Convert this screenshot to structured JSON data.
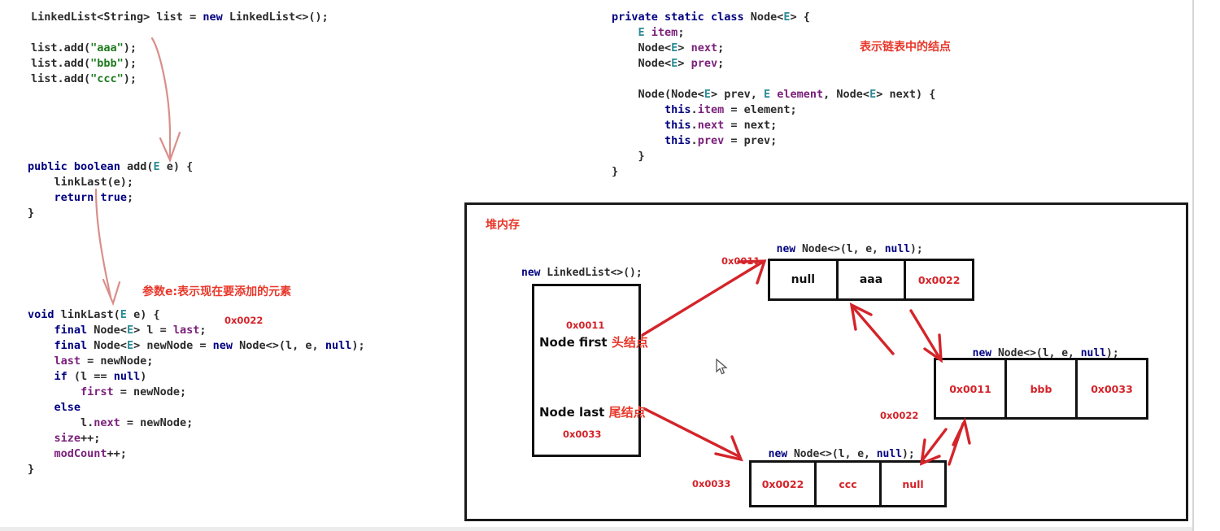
{
  "left_code_top": {
    "lines": [
      [
        {
          "t": "LinkedList<String> list = ",
          "c": "pln"
        },
        {
          "t": "new",
          "c": "kw"
        },
        {
          "t": " LinkedList<>();",
          "c": "pln"
        }
      ],
      [],
      [
        {
          "t": "list.add(",
          "c": "pln"
        },
        {
          "t": "\"aaa\"",
          "c": "str"
        },
        {
          "t": ");",
          "c": "pln"
        }
      ],
      [
        {
          "t": "list.add(",
          "c": "pln"
        },
        {
          "t": "\"bbb\"",
          "c": "str"
        },
        {
          "t": ");",
          "c": "pln"
        }
      ],
      [
        {
          "t": "list.add(",
          "c": "pln"
        },
        {
          "t": "\"ccc\"",
          "c": "str"
        },
        {
          "t": ");",
          "c": "pln"
        }
      ]
    ]
  },
  "left_code_add": {
    "lines": [
      [
        {
          "t": "public",
          "c": "kw"
        },
        {
          "t": " ",
          "c": "pln"
        },
        {
          "t": "boolean",
          "c": "kw"
        },
        {
          "t": " add(",
          "c": "pln"
        },
        {
          "t": "E",
          "c": "tv"
        },
        {
          "t": " e) {",
          "c": "pln"
        }
      ],
      [
        {
          "t": "    linkLast(e);",
          "c": "pln"
        }
      ],
      [
        {
          "t": "    ",
          "c": "pln"
        },
        {
          "t": "return",
          "c": "kw"
        },
        {
          "t": " ",
          "c": "pln"
        },
        {
          "t": "true",
          "c": "kw"
        },
        {
          "t": ";",
          "c": "pln"
        }
      ],
      [
        {
          "t": "}",
          "c": "pln"
        }
      ]
    ]
  },
  "left_code_linklast": {
    "lines": [
      [
        {
          "t": "void",
          "c": "kw"
        },
        {
          "t": " linkLast(",
          "c": "pln"
        },
        {
          "t": "E",
          "c": "tv"
        },
        {
          "t": " e) {",
          "c": "pln"
        }
      ],
      [
        {
          "t": "    ",
          "c": "pln"
        },
        {
          "t": "final",
          "c": "kw"
        },
        {
          "t": " Node<",
          "c": "pln"
        },
        {
          "t": "E",
          "c": "tv"
        },
        {
          "t": "> l = ",
          "c": "pln"
        },
        {
          "t": "last",
          "c": "fld"
        },
        {
          "t": ";",
          "c": "pln"
        }
      ],
      [
        {
          "t": "    ",
          "c": "pln"
        },
        {
          "t": "final",
          "c": "kw"
        },
        {
          "t": " Node<",
          "c": "pln"
        },
        {
          "t": "E",
          "c": "tv"
        },
        {
          "t": "> newNode = ",
          "c": "pln"
        },
        {
          "t": "new",
          "c": "kw"
        },
        {
          "t": " Node<>(l, e, ",
          "c": "pln"
        },
        {
          "t": "null",
          "c": "kw"
        },
        {
          "t": ");",
          "c": "pln"
        }
      ],
      [
        {
          "t": "    ",
          "c": "pln"
        },
        {
          "t": "last",
          "c": "fld"
        },
        {
          "t": " = newNode;",
          "c": "pln"
        }
      ],
      [
        {
          "t": "    ",
          "c": "pln"
        },
        {
          "t": "if",
          "c": "kw"
        },
        {
          "t": " (l == ",
          "c": "pln"
        },
        {
          "t": "null",
          "c": "kw"
        },
        {
          "t": ")",
          "c": "pln"
        }
      ],
      [
        {
          "t": "        ",
          "c": "pln"
        },
        {
          "t": "first",
          "c": "fld"
        },
        {
          "t": " = newNode;",
          "c": "pln"
        }
      ],
      [
        {
          "t": "    ",
          "c": "pln"
        },
        {
          "t": "else",
          "c": "kw"
        },
        {
          "t": "",
          "c": "pln"
        }
      ],
      [
        {
          "t": "        l.",
          "c": "pln"
        },
        {
          "t": "next",
          "c": "fld"
        },
        {
          "t": " = newNode;",
          "c": "pln"
        }
      ],
      [
        {
          "t": "    ",
          "c": "pln"
        },
        {
          "t": "size",
          "c": "fld"
        },
        {
          "t": "++;",
          "c": "pln"
        }
      ],
      [
        {
          "t": "    ",
          "c": "pln"
        },
        {
          "t": "modCount",
          "c": "fld"
        },
        {
          "t": "++;",
          "c": "pln"
        }
      ],
      [
        {
          "t": "}",
          "c": "pln"
        }
      ]
    ]
  },
  "right_code_node": {
    "lines": [
      [
        {
          "t": "private",
          "c": "kw"
        },
        {
          "t": " ",
          "c": "pln"
        },
        {
          "t": "static",
          "c": "kw"
        },
        {
          "t": " ",
          "c": "pln"
        },
        {
          "t": "class",
          "c": "kw"
        },
        {
          "t": " Node<",
          "c": "pln"
        },
        {
          "t": "E",
          "c": "tv"
        },
        {
          "t": "> {",
          "c": "pln"
        }
      ],
      [
        {
          "t": "    ",
          "c": "pln"
        },
        {
          "t": "E",
          "c": "tv"
        },
        {
          "t": " ",
          "c": "pln"
        },
        {
          "t": "item",
          "c": "fld"
        },
        {
          "t": ";",
          "c": "pln"
        }
      ],
      [
        {
          "t": "    Node<",
          "c": "pln"
        },
        {
          "t": "E",
          "c": "tv"
        },
        {
          "t": "> ",
          "c": "pln"
        },
        {
          "t": "next",
          "c": "fld"
        },
        {
          "t": ";",
          "c": "pln"
        }
      ],
      [
        {
          "t": "    Node<",
          "c": "pln"
        },
        {
          "t": "E",
          "c": "tv"
        },
        {
          "t": "> ",
          "c": "pln"
        },
        {
          "t": "prev",
          "c": "fld"
        },
        {
          "t": ";",
          "c": "pln"
        }
      ],
      [],
      [
        {
          "t": "    Node(Node<",
          "c": "pln"
        },
        {
          "t": "E",
          "c": "tv"
        },
        {
          "t": "> prev, ",
          "c": "pln"
        },
        {
          "t": "E",
          "c": "tv"
        },
        {
          "t": " ",
          "c": "pln"
        },
        {
          "t": "element",
          "c": "fld"
        },
        {
          "t": ", Node<",
          "c": "pln"
        },
        {
          "t": "E",
          "c": "tv"
        },
        {
          "t": "> next) {",
          "c": "pln"
        }
      ],
      [
        {
          "t": "        ",
          "c": "pln"
        },
        {
          "t": "this",
          "c": "kw"
        },
        {
          "t": ".",
          "c": "pln"
        },
        {
          "t": "item",
          "c": "fld"
        },
        {
          "t": " = element;",
          "c": "pln"
        }
      ],
      [
        {
          "t": "        ",
          "c": "pln"
        },
        {
          "t": "this",
          "c": "kw"
        },
        {
          "t": ".",
          "c": "pln"
        },
        {
          "t": "next",
          "c": "fld"
        },
        {
          "t": " = next;",
          "c": "pln"
        }
      ],
      [
        {
          "t": "        ",
          "c": "pln"
        },
        {
          "t": "this",
          "c": "kw"
        },
        {
          "t": ".",
          "c": "pln"
        },
        {
          "t": "prev",
          "c": "fld"
        },
        {
          "t": " = prev;",
          "c": "pln"
        }
      ],
      [
        {
          "t": "    }",
          "c": "pln"
        }
      ],
      [
        {
          "t": "}",
          "c": "pln"
        }
      ]
    ]
  },
  "annotations": {
    "node_class_note": "表示链表中的结点",
    "param_e_note": "参数e:表示现在要添加的元素",
    "linklast_addr_note": "0x0022"
  },
  "heap": {
    "title": "堆内存",
    "linkedlist_caption": "new LinkedList<>();",
    "linkedlist_caption_kw": "new",
    "first_addr": "0x0011",
    "first_label": "Node first",
    "first_label_cn": "头结点",
    "last_label": "Node last",
    "last_label_cn": "尾结点",
    "last_addr": "0x0033",
    "node_caption_kw_new": "new",
    "node_caption_rest": " Node<>(l, e, ",
    "node_caption_kw_null": "null",
    "node_caption_end": ");",
    "nodes": [
      {
        "name": "node-aaa",
        "caption": "new Node<>(l, e, null);",
        "pointer_label": "0x0011",
        "cells": [
          {
            "text": "null",
            "style": "cell-black"
          },
          {
            "text": "aaa",
            "style": "cell-black"
          },
          {
            "text": "0x0022",
            "style": "cell-red"
          }
        ]
      },
      {
        "name": "node-bbb",
        "caption": "new Node<>(l, e, null);",
        "pointer_label": "0x0022",
        "cells": [
          {
            "text": "0x0011",
            "style": "cell-red"
          },
          {
            "text": "bbb",
            "style": "cell-red"
          },
          {
            "text": "0x0033",
            "style": "cell-red"
          }
        ]
      },
      {
        "name": "node-ccc",
        "caption": "new Node<>(l, e, null);",
        "pointer_label": "0x0033",
        "cells": [
          {
            "text": "0x0022",
            "style": "cell-red"
          },
          {
            "text": "ccc",
            "style": "cell-red"
          },
          {
            "text": "null",
            "style": "cell-red"
          }
        ]
      }
    ]
  },
  "colors": {
    "annotation_red": "#e8382b",
    "address_red": "#d4242a",
    "keyword_navy": "#000080",
    "typevar_teal": "#2b8b96",
    "field_purple": "#7a1f7a",
    "string_green": "#1f7a1f",
    "box_border": "#111111"
  }
}
